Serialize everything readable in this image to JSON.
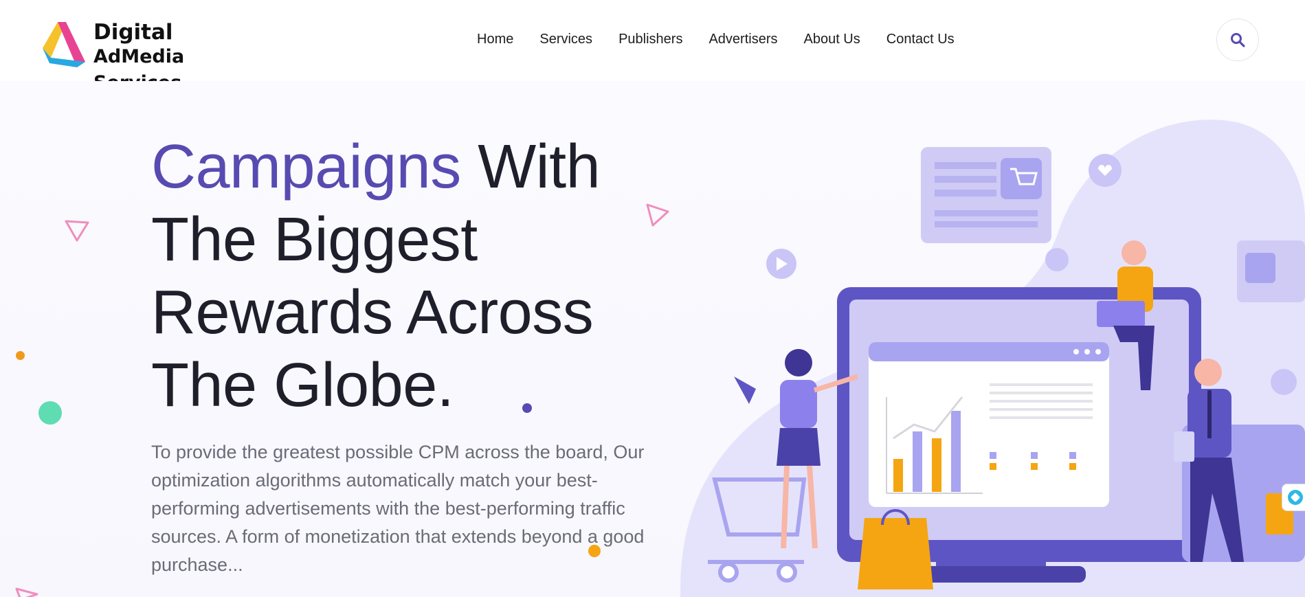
{
  "brand": {
    "line1": "Digital",
    "line2": "AdMedia Services",
    "logo_icon": "triangle-logo-icon"
  },
  "nav": {
    "items": [
      {
        "label": "Home"
      },
      {
        "label": "Services"
      },
      {
        "label": "Publishers"
      },
      {
        "label": "Advertisers"
      },
      {
        "label": "About Us"
      },
      {
        "label": "Contact Us"
      }
    ],
    "search_icon": "search-icon"
  },
  "hero": {
    "headline_accent": "Campaigns",
    "headline_rest_1": " With",
    "headline_rest_2": "The Biggest",
    "headline_rest_3": "Rewards Across",
    "headline_rest_4": "The Globe.",
    "description": "To provide the greatest possible CPM across the board, Our optimization algorithms automatically match your best-performing advertisements with the best-performing traffic sources. A form of monetization that extends beyond a good purchase..."
  },
  "colors": {
    "accent": "#574bb1",
    "illustration_light": "#d7d5f7",
    "illustration_mid": "#a9a4ef",
    "illustration_dark": "#5e55c4",
    "highlight": "#f5a511"
  },
  "widget": {
    "icon": "chat-widget-icon"
  }
}
